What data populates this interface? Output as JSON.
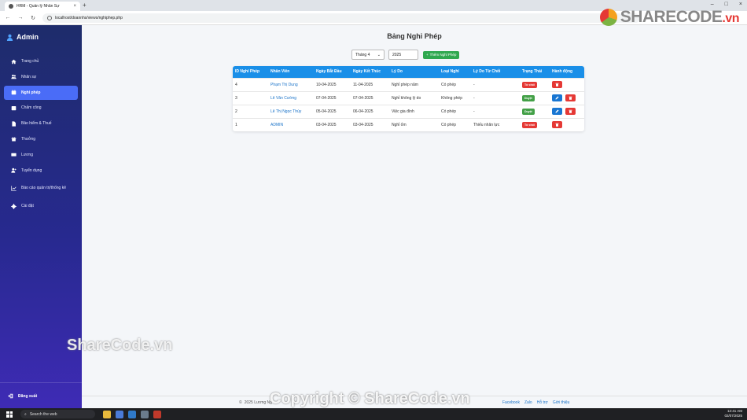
{
  "browser": {
    "tab_title": "HRM - Quản lý Nhân Sự",
    "url": "localhost/doannhs/views/nghiphep.php"
  },
  "sidebar": {
    "brand": "Admin",
    "items": [
      {
        "label": "Trang chủ",
        "icon": "home-icon"
      },
      {
        "label": "Nhân sự",
        "icon": "users-icon"
      },
      {
        "label": "Nghỉ phép",
        "icon": "calendar-icon",
        "active": true
      },
      {
        "label": "Chấm công",
        "icon": "clock-icon"
      },
      {
        "label": "Bảo hiểm & Thuế",
        "icon": "document-icon"
      },
      {
        "label": "Thưởng",
        "icon": "gift-icon"
      },
      {
        "label": "Lương",
        "icon": "money-icon"
      },
      {
        "label": "Tuyển dụng",
        "icon": "user-plus-icon"
      },
      {
        "label": "Báo cáo quản trị/thống kê",
        "icon": "chart-icon"
      },
      {
        "label": "Cài đặt",
        "icon": "gear-icon"
      }
    ],
    "logout": "Đăng xuất"
  },
  "main": {
    "title": "Bảng Nghỉ Phép",
    "month_select": "Tháng 4",
    "year_input": "2025",
    "add_button": "Thêm Nghỉ Phép",
    "table": {
      "headers": [
        "ID Nghỉ Phép",
        "Nhân Viên",
        "Ngày Bắt Đầu",
        "Ngày Kết Thúc",
        "Lý Do",
        "Loại Nghỉ",
        "Lý Do Từ Chối",
        "Trạng Thái",
        "Hành động"
      ],
      "rows": [
        {
          "id": "4",
          "name": "Phạm Thị Dung",
          "start": "10-04-2025",
          "end": "11-04-2025",
          "reason": "Nghỉ phép năm",
          "type": "Có phép",
          "reject_reason": "-",
          "status": "Từ chối",
          "status_kind": "reject",
          "editable": false
        },
        {
          "id": "3",
          "name": "Lê Văn Cường",
          "start": "07-04-2025",
          "end": "07-04-2025",
          "reason": "Nghỉ không lý do",
          "type": "Không phép",
          "reject_reason": "-",
          "status": "Duyệt",
          "status_kind": "approve",
          "editable": true
        },
        {
          "id": "2",
          "name": "Lê Thị Ngọc Thúy",
          "start": "05-04-2025",
          "end": "06-04-2025",
          "reason": "Việc gia đình",
          "type": "Có phép",
          "reject_reason": "-",
          "status": "Duyệt",
          "status_kind": "approve",
          "editable": true
        },
        {
          "id": "1",
          "name": "ADMIN",
          "start": "03-04-2025",
          "end": "03-04-2025",
          "reason": "Nghỉ ốm",
          "type": "Có phép",
          "reject_reason": "Thiếu nhân lực",
          "status": "Từ chối",
          "status_kind": "reject",
          "editable": false
        }
      ]
    }
  },
  "footer": {
    "copyright": "2025 Lương Ng",
    "links": [
      "Facebook",
      "Zalo",
      "Hỗ trợ",
      "Giới thiệu"
    ]
  },
  "watermarks": {
    "logo_main": "SHARECODE",
    "logo_suffix": ".vn",
    "middle": "ShareCode.vn",
    "bottom": "Copyright © ShareCode.vn"
  },
  "taskbar": {
    "search_placeholder": "Search the web",
    "time": "12:41 AM",
    "date": "02/07/2025"
  },
  "colors": {
    "sidebar_top": "#1e2c6b",
    "sidebar_bottom": "#3e2bb5",
    "active_item": "#4a6cf7",
    "table_header": "#1a8fe8",
    "add_button": "#2fa84f",
    "reject": "#e53935",
    "approve": "#43a047"
  }
}
